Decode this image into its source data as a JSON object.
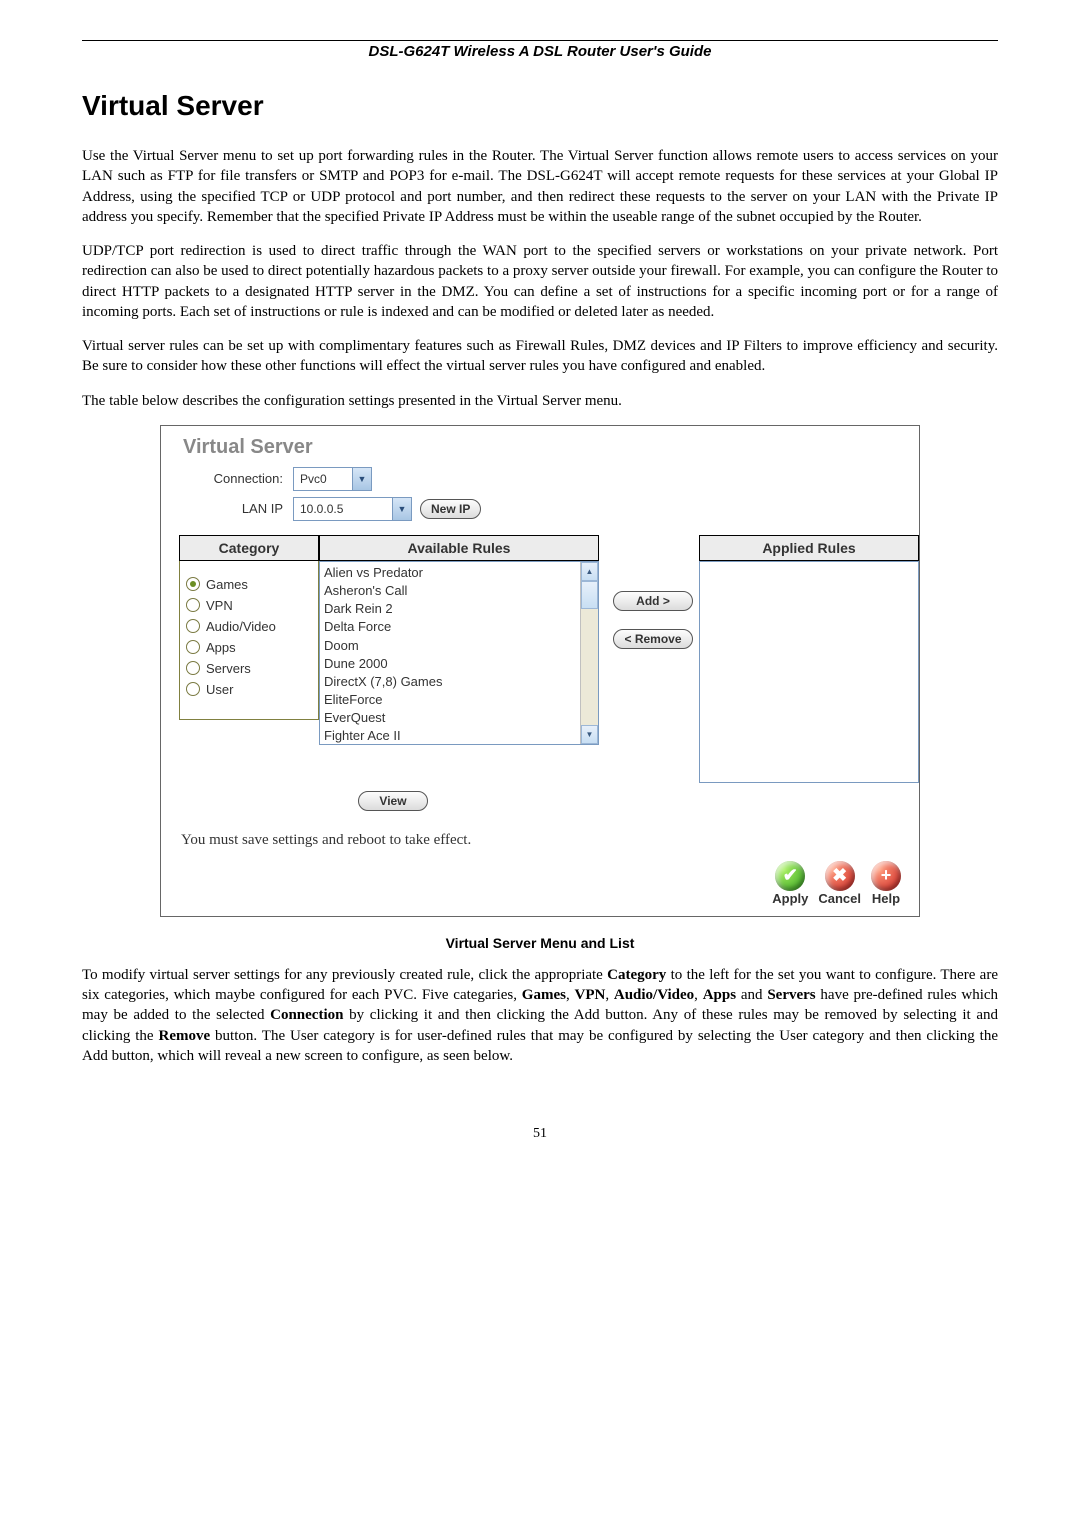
{
  "header": {
    "guide_title": "DSL-G624T Wireless A DSL Router User's Guide"
  },
  "h1": "Virtual Server",
  "p1": "Use the Virtual Server menu to set up port forwarding rules in the Router. The Virtual Server function allows remote users to access services on your LAN such as FTP for file transfers or SMTP and POP3 for e-mail.  The DSL-G624T will accept remote requests for these services at your Global IP Address, using the specified TCP or UDP protocol and port number, and then redirect these requests to the server on your LAN with the Private IP address you specify. Remember that the specified Private IP Address must be within the useable range of the subnet occupied by the Router.",
  "p2": "UDP/TCP port redirection is used to direct traffic through the WAN port to the specified servers or workstations on your private network. Port redirection can also be used to direct potentially hazardous packets to a proxy server outside your firewall. For example, you can configure the Router to direct HTTP packets to a designated HTTP server in the DMZ. You can define a set of instructions for a specific incoming port or for a range of incoming ports. Each set of instructions or rule is indexed and can be modified or deleted later as needed.",
  "p3": "Virtual server rules can be set up with complimentary features such as Firewall Rules, DMZ devices and IP Filters to improve efficiency and security. Be sure to consider how these other functions will effect the virtual server rules you have configured and enabled.",
  "p4": "The table below describes the configuration settings presented in the Virtual Server menu.",
  "panel": {
    "title": "Virtual Server",
    "connection_label": "Connection:",
    "connection_value": "Pvc0",
    "lanip_label": "LAN IP",
    "lanip_value": "10.0.0.5",
    "newip_btn": "New IP",
    "heads": {
      "category": "Category",
      "available": "Available Rules",
      "applied": "Applied Rules"
    },
    "categories": [
      {
        "label": "Games",
        "selected": true
      },
      {
        "label": "VPN",
        "selected": false
      },
      {
        "label": "Audio/Video",
        "selected": false
      },
      {
        "label": "Apps",
        "selected": false
      },
      {
        "label": "Servers",
        "selected": false
      },
      {
        "label": "User",
        "selected": false
      }
    ],
    "available_rules": [
      "Alien vs Predator",
      "Asheron's Call",
      "Dark Rein 2",
      "Delta Force",
      "Doom",
      "Dune 2000",
      "DirectX (7,8) Games",
      "EliteForce",
      "EverQuest",
      "Fighter Ace II"
    ],
    "add_btn": "Add >",
    "remove_btn": "< Remove",
    "view_btn": "View",
    "footer_note": "You must save settings and reboot to take effect.",
    "actions": {
      "apply": "Apply",
      "cancel": "Cancel",
      "help": "Help"
    },
    "glyphs": {
      "check": "✔",
      "cross": "✖",
      "plus": "+"
    }
  },
  "caption": "Virtual Server Menu and List",
  "p5_a": "To modify virtual server settings for any previously created rule, click the appropriate ",
  "p5_b": "Category",
  "p5_c": " to the left for the set you want to configure. There are six categories, which maybe configured for each PVC. Five categaries, ",
  "p5_d": "Games",
  "p5_e": ", ",
  "p5_f": "VPN",
  "p5_g": ", ",
  "p5_h": "Audio/Video",
  "p5_i": ", ",
  "p5_j": "Apps",
  "p5_k": " and ",
  "p5_l": "Servers",
  "p5_m": " have pre-defined rules which may be added to the selected ",
  "p5_n": "Connection",
  "p5_o": " by clicking it and then clicking the Add button. Any of these rules may be removed by selecting it and clicking the ",
  "p5_p": "Remove",
  "p5_q": " button. The User category is for user-defined rules that may be configured by selecting the User category and then clicking the Add button, which will reveal a new screen to configure, as seen below.",
  "page_num": "51"
}
